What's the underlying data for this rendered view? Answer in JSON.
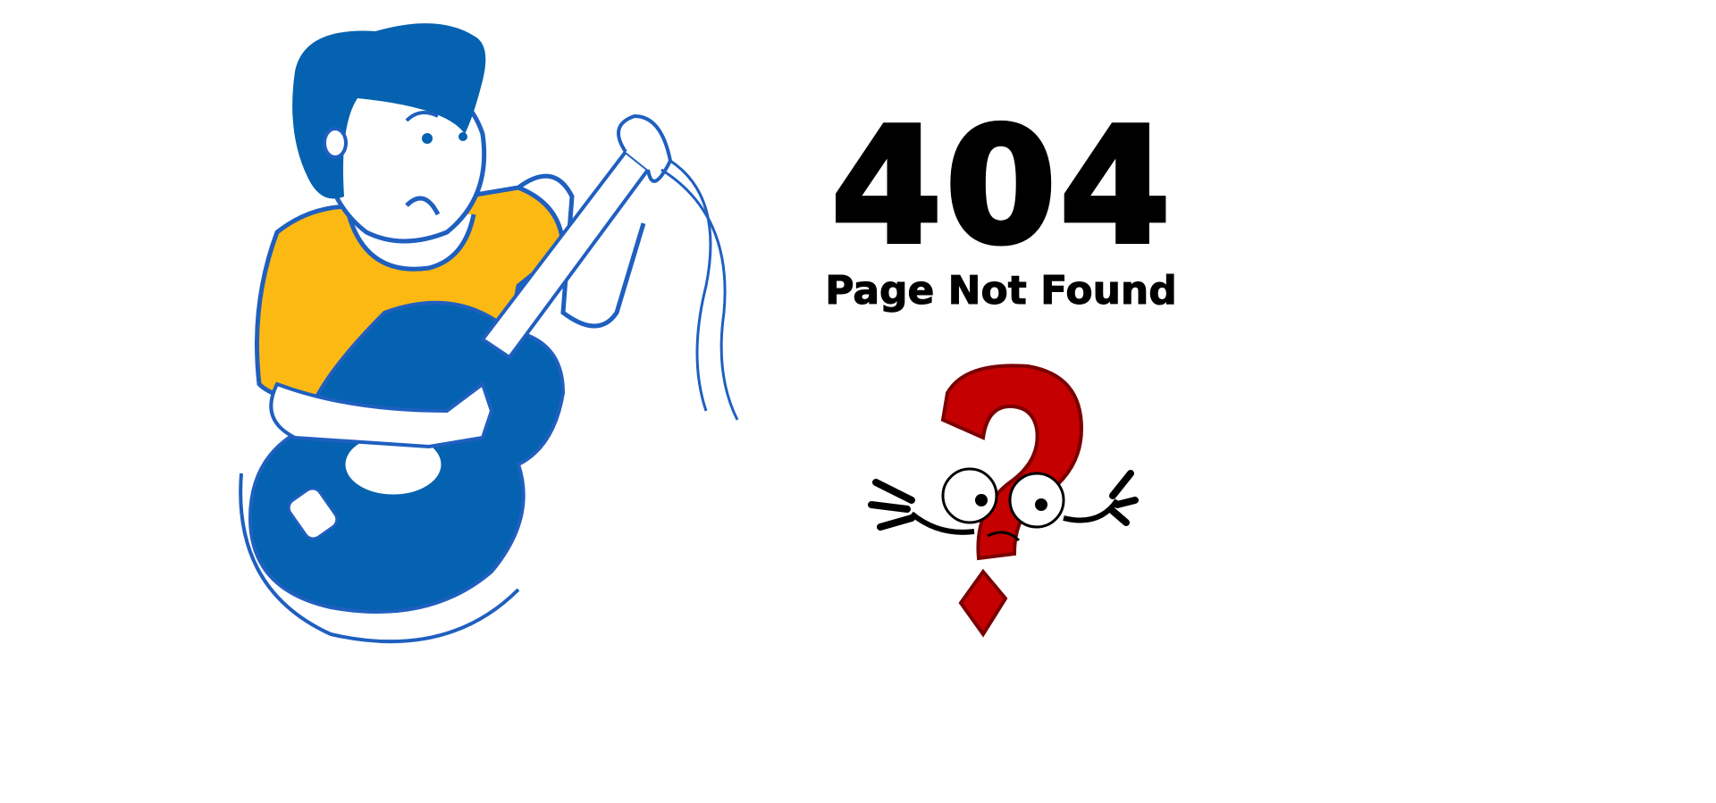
{
  "error": {
    "code": "404",
    "message": "Page Not Found"
  },
  "illustration": {
    "icon": "confused-guitarist-illustration",
    "colors": {
      "blue": "#0462b0",
      "yellow": "#fdb913",
      "outline": "#1f5fbf"
    }
  },
  "question_mark": {
    "icon": "confused-question-mark-icon",
    "colors": {
      "red": "#c40000",
      "dark_red": "#7a0000"
    }
  }
}
